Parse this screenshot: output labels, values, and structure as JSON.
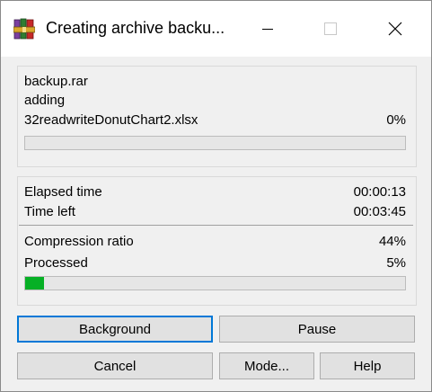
{
  "window": {
    "title": "Creating archive backu...",
    "controls": {
      "minimize": "—",
      "maximize": "☐",
      "close": "✕"
    }
  },
  "file_section": {
    "archive_name": "backup.rar",
    "operation": "adding",
    "current_file": "32readwriteDonutChart2.xlsx",
    "file_percent": "0%",
    "file_progress": 0.0
  },
  "stats": {
    "elapsed_label": "Elapsed time",
    "elapsed_value": "00:00:13",
    "left_label": "Time left",
    "left_value": "00:03:45",
    "ratio_label": "Compression ratio",
    "ratio_value": "44%",
    "processed_label": "Processed",
    "processed_value": "5%",
    "processed_progress": 0.05
  },
  "buttons": {
    "background": "Background",
    "pause": "Pause",
    "cancel": "Cancel",
    "mode": "Mode...",
    "help": "Help"
  },
  "colors": {
    "progress_fill": "#06b025",
    "default_button_border": "#0078d7"
  },
  "icons": {
    "app": "winrar-books-icon",
    "minimize": "minimize-icon",
    "maximize": "maximize-icon",
    "close": "close-icon"
  }
}
